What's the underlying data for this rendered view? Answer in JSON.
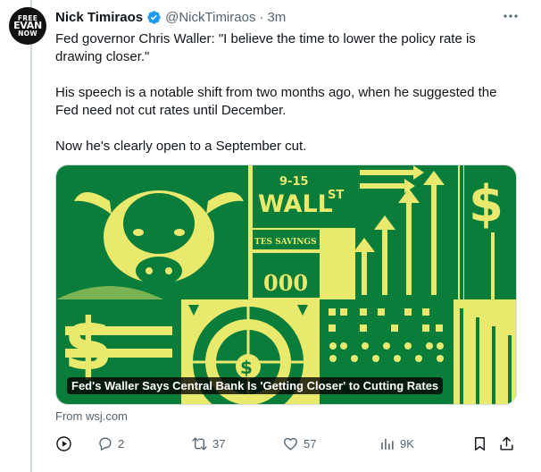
{
  "avatar": {
    "lines": [
      "FREE",
      "EVAN",
      "NOW"
    ]
  },
  "author": {
    "name": "Nick Timiraos",
    "handle": "@NickTimiraos",
    "separator": "·",
    "time": "3m"
  },
  "tweet": {
    "paragraphs": [
      "Fed governor Chris Waller: \"I believe the time to lower the policy rate is drawing closer.\"",
      "His speech is a notable shift from two months ago, when he suggested the Fed need not cut rates until December.",
      "Now he's clearly open to a September cut."
    ]
  },
  "card": {
    "title": "Fed's Waller Says Central Bank Is 'Getting Closer' to Cutting Rates",
    "art_text": {
      "street_sign_number": "9-15",
      "street_sign_name": "WALL",
      "street_sign_suffix": "ST",
      "banner": "TES SAVINGS",
      "bill_digits": "000",
      "coin_symbol": "$"
    },
    "source": "From wsj.com"
  },
  "actions": {
    "replies": "2",
    "reposts": "37",
    "likes": "57",
    "views": "9K"
  },
  "colors": {
    "accent": "#1d9bf0",
    "text": "#0f1419",
    "muted": "#536471",
    "art_yellow": "#e9e96d",
    "art_green": "#0b7d3b"
  }
}
